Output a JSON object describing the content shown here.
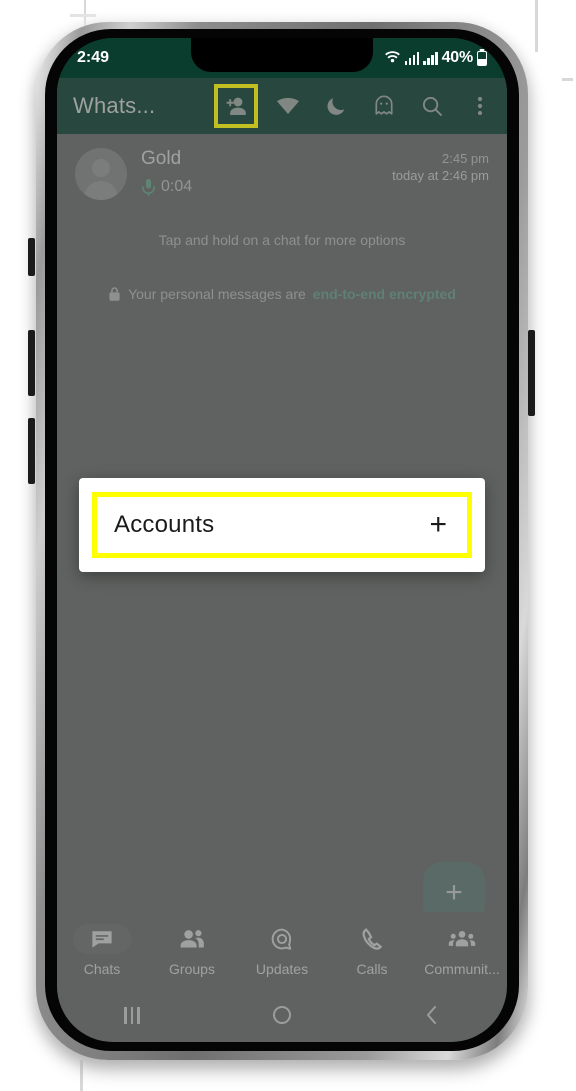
{
  "status_bar": {
    "time": "2:49",
    "battery_percent": "40%",
    "wifi_icon": "wifi-icon",
    "signal_icon_1": "signal-bars-icon",
    "signal_icon_2": "signal-bars-icon",
    "battery_icon": "battery-icon"
  },
  "app_bar": {
    "title": "Whats...",
    "icons": [
      {
        "name": "add-person-icon",
        "highlighted": true
      },
      {
        "name": "wifi-cone-icon",
        "highlighted": false
      },
      {
        "name": "moon-icon",
        "highlighted": false
      },
      {
        "name": "ghost-icon",
        "highlighted": false
      },
      {
        "name": "search-icon",
        "highlighted": false
      },
      {
        "name": "overflow-menu-icon",
        "highlighted": false
      }
    ]
  },
  "chat_list": {
    "rows": [
      {
        "avatar": "default-avatar-icon",
        "name": "Gold",
        "attachment_icon": "microphone-icon",
        "duration": "0:04",
        "time": "2:45 pm",
        "time_secondary": "today at 2:46 pm"
      }
    ],
    "hint": "Tap and hold on a chat for more options",
    "encryption": {
      "lock_icon": "lock-icon",
      "prefix": "Your personal messages are ",
      "emphasis": "end-to-end encrypted"
    }
  },
  "fab": {
    "icon": "plus-icon",
    "label": "+"
  },
  "bottom_nav": {
    "items": [
      {
        "label": "Chats",
        "icon": "chats-icon",
        "active": true
      },
      {
        "label": "Groups",
        "icon": "groups-icon",
        "active": false
      },
      {
        "label": "Updates",
        "icon": "updates-icon",
        "active": false
      },
      {
        "label": "Calls",
        "icon": "calls-icon",
        "active": false
      },
      {
        "label": "Communit...",
        "icon": "communities-icon",
        "active": false
      }
    ]
  },
  "dialog": {
    "title": "Accounts",
    "add_label": "+",
    "add_icon": "plus-icon",
    "highlight_color": "#ffff00"
  },
  "system_nav": {
    "recents_icon": "recents-icon",
    "home_icon": "home-icon",
    "back_icon": "back-icon"
  },
  "colors": {
    "brand_green": "#0b3d2e",
    "accent_green": "#14805a",
    "highlight_yellow": "#ffff00",
    "scrim_gray": "#808080"
  }
}
